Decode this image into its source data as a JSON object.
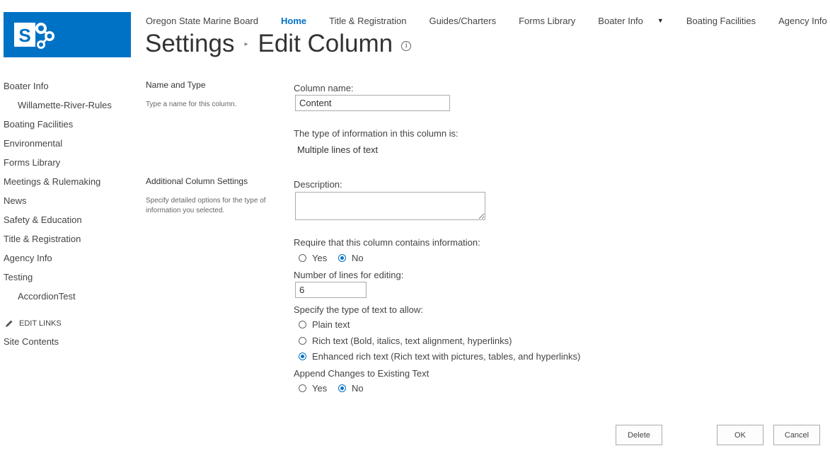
{
  "colors": {
    "brand": "#0072c6",
    "text": "#444444"
  },
  "logo": {
    "icon": "sharepoint-logo-icon"
  },
  "topnav": {
    "site_name": "Oregon State Marine Board",
    "items": [
      {
        "label": "Home",
        "active": true
      },
      {
        "label": "Title & Registration"
      },
      {
        "label": "Guides/Charters"
      },
      {
        "label": "Forms Library"
      },
      {
        "label": "Boater Info",
        "has_dropdown": true
      },
      {
        "label": "Boating Facilities"
      },
      {
        "label": "Agency Info"
      }
    ]
  },
  "page": {
    "breadcrumb_parent": "Settings",
    "title": "Edit Column",
    "info_glyph": "i"
  },
  "leftnav": {
    "items": [
      {
        "label": "Boater Info"
      },
      {
        "label": "Willamette-River-Rules",
        "sub": true
      },
      {
        "label": "Boating Facilities"
      },
      {
        "label": "Environmental"
      },
      {
        "label": "Forms Library"
      },
      {
        "label": "Meetings & Rulemaking"
      },
      {
        "label": "News"
      },
      {
        "label": "Safety & Education"
      },
      {
        "label": "Title & Registration"
      },
      {
        "label": "Agency Info"
      },
      {
        "label": "Testing"
      },
      {
        "label": "AccordionTest",
        "sub": true
      }
    ],
    "edit_links": "EDIT LINKS",
    "site_contents": "Site Contents"
  },
  "sections": {
    "name_type": {
      "title": "Name and Type",
      "desc": "Type a name for this column."
    },
    "additional": {
      "title": "Additional Column Settings",
      "desc": "Specify detailed options for the type of information you selected."
    }
  },
  "form": {
    "column_name_label": "Column name:",
    "column_name_value": "Content",
    "type_label": "The type of information in this column is:",
    "type_value": "Multiple lines of text",
    "description_label": "Description:",
    "require_label": "Require that this column contains information:",
    "require_yes": "Yes",
    "require_no": "No",
    "require_selected": "No",
    "lines_label": "Number of lines for editing:",
    "lines_value": "6",
    "text_type_label": "Specify the type of text to allow:",
    "text_type_options": [
      "Plain text",
      "Rich text (Bold, italics, text alignment, hyperlinks)",
      "Enhanced rich text (Rich text with pictures, tables, and hyperlinks)"
    ],
    "text_type_selected": 2,
    "append_label": "Append Changes to Existing Text",
    "append_yes": "Yes",
    "append_no": "No",
    "append_selected": "No"
  },
  "buttons": {
    "delete": "Delete",
    "ok": "OK",
    "cancel": "Cancel"
  }
}
